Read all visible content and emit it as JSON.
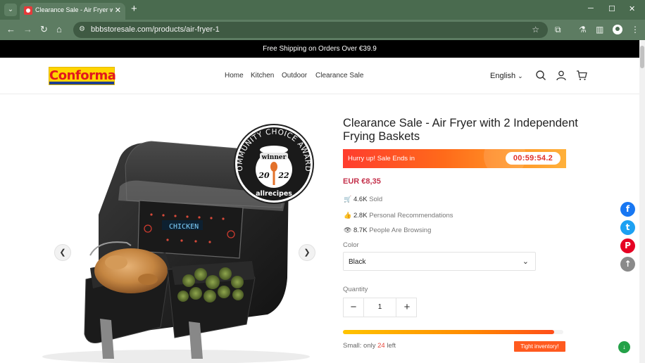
{
  "browser": {
    "tab_title": "Clearance Sale - Air Fryer with",
    "url": "bbbstoresale.com/products/air-fryer-1"
  },
  "announcement": "Free Shipping on Orders Over €39.9",
  "header": {
    "logo_text": "Conforma",
    "nav": [
      "Home",
      "Kitchen",
      "Outdoor",
      "Clearance Sale"
    ],
    "language": "English"
  },
  "gallery": {
    "badge_top": "COMMUNITY CHOICE AWARDS",
    "badge_winner": "winner",
    "badge_year_left": "20",
    "badge_year_right": "22",
    "badge_brand": "allrecipes",
    "display_text": "CHICKEN"
  },
  "product": {
    "title": "Clearance Sale - Air Fryer with 2 Independent Frying Baskets",
    "sale_text": "Hurry up! Sale Ends in",
    "timer": "00:59:54.2",
    "price": "EUR €8,35",
    "stats": [
      {
        "icon": "cart-icon",
        "value": "4.6K",
        "label": "Sold"
      },
      {
        "icon": "thumbs-up-icon",
        "value": "2.8K",
        "label": "Personal Recommendations"
      },
      {
        "icon": "eye-icon",
        "value": "8.7K",
        "label": "People Are Browsing"
      }
    ],
    "color_label": "Color",
    "color_value": "Black",
    "quantity_label": "Quantity",
    "quantity_value": "1",
    "stock_prefix": "Small: only",
    "stock_count": "24",
    "stock_suffix": "left",
    "stock_level": 0.96,
    "inventory_badge": "Tight inventory!"
  },
  "social": [
    "f",
    "t",
    "P",
    "↑"
  ],
  "colors": {
    "browser_frame": "#4a6b4f",
    "price": "#c4314b",
    "timer": "#e0302a",
    "facebook": "#1877f2",
    "twitter": "#1da1f2",
    "pinterest": "#e60023"
  }
}
